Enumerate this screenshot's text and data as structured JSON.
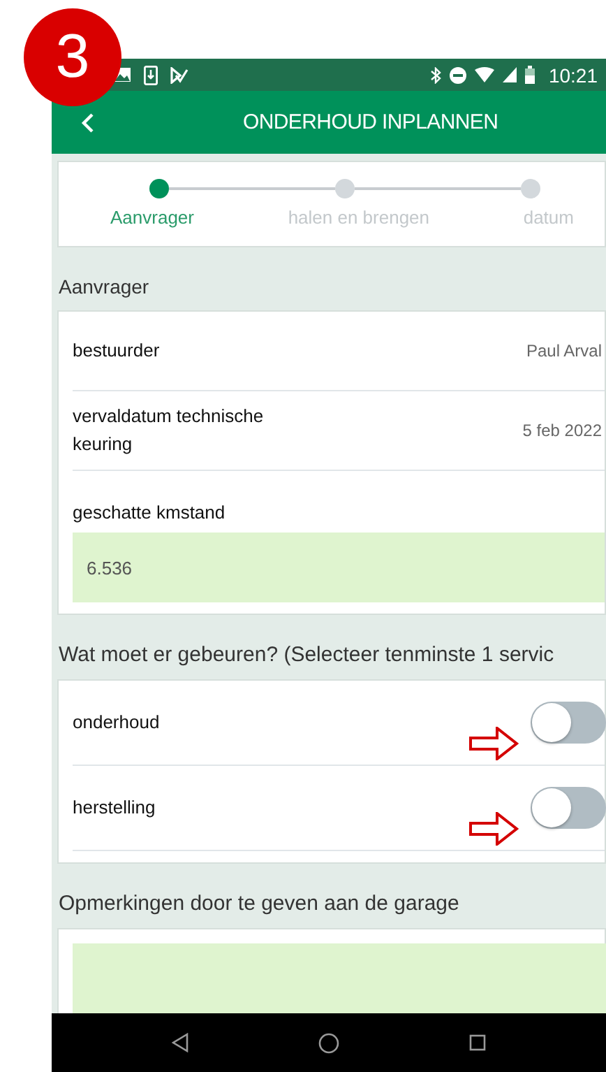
{
  "badge": "3",
  "status_bar": {
    "time": "10:21"
  },
  "app_bar": {
    "title": "ONDERHOUD INPLANNEN"
  },
  "stepper": [
    {
      "label": "Aanvrager",
      "selected": true
    },
    {
      "label": "halen en brengen",
      "selected": false
    },
    {
      "label": "datum",
      "selected": false
    }
  ],
  "requester": {
    "heading": "Aanvrager",
    "rows": [
      {
        "kind": "text",
        "label": "bestuurder",
        "value": "Paul Arval"
      },
      {
        "kind": "text",
        "label": "vervaldatum technische keuring",
        "value": "5 feb 2022"
      },
      {
        "kind": "input",
        "label": "geschatte kmstand",
        "value": "6.536"
      }
    ]
  },
  "services": {
    "heading": "Wat moet er gebeuren? (Selecteer tenminste 1 servic",
    "items": [
      {
        "label": "onderhoud",
        "on": false
      },
      {
        "label": "herstelling",
        "on": false
      }
    ]
  },
  "remarks": {
    "heading": "Opmerkingen door te geven aan de garage"
  }
}
